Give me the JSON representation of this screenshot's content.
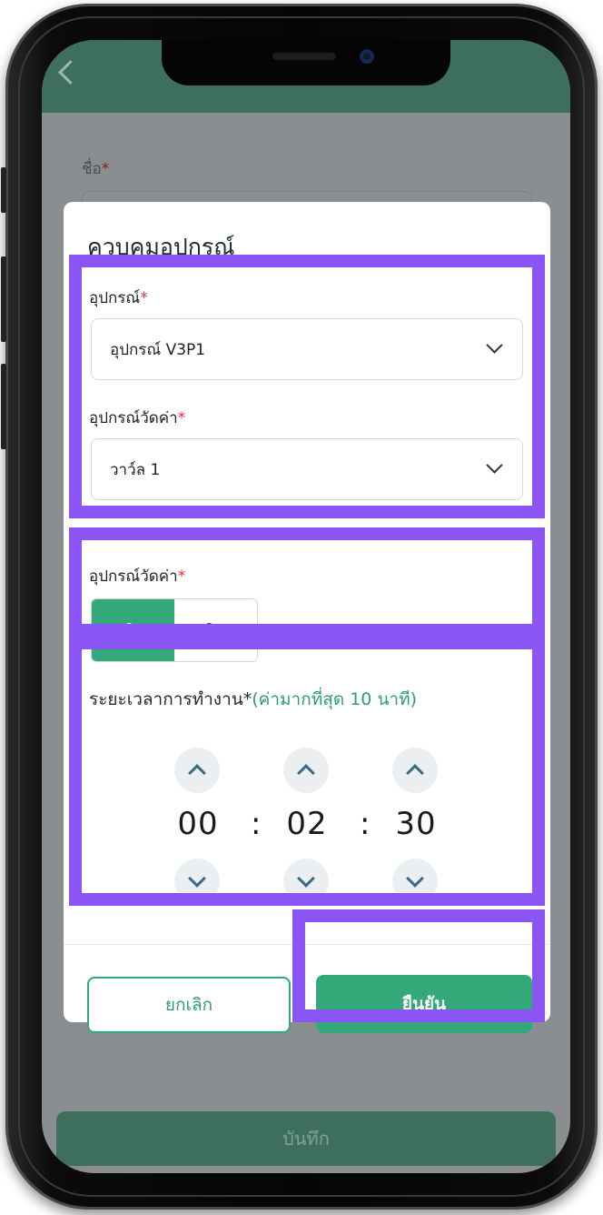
{
  "app": {
    "name_label": "ชื่อ",
    "required_mark": "*",
    "save_button": "บันทึก"
  },
  "dialog": {
    "title": "ควบคุมอุปกรณ์",
    "device": {
      "label": "อุปกรณ์",
      "value": "อุปกรณ์ V3P1"
    },
    "sensor": {
      "label": "อุปกรณ์วัดค่า",
      "value": "วาว์ล 1"
    },
    "state": {
      "label": "อุปกรณ์วัดค่า",
      "on_label": "เปิด",
      "off_label": "ปิด",
      "selected": "on"
    },
    "duration": {
      "label": "ระยะเวลาการทำงาน*",
      "hint": "(ค่ามากที่สุด 10 นาที)",
      "hours": "00",
      "minutes": "02",
      "seconds": "30",
      "separator": ":"
    },
    "cancel_button": "ยกเลิก",
    "confirm_button": "ยืนยัน"
  },
  "colors": {
    "highlight": "#8b55f6",
    "primary_green": "#33a879",
    "header_green": "#3e6e5c"
  }
}
